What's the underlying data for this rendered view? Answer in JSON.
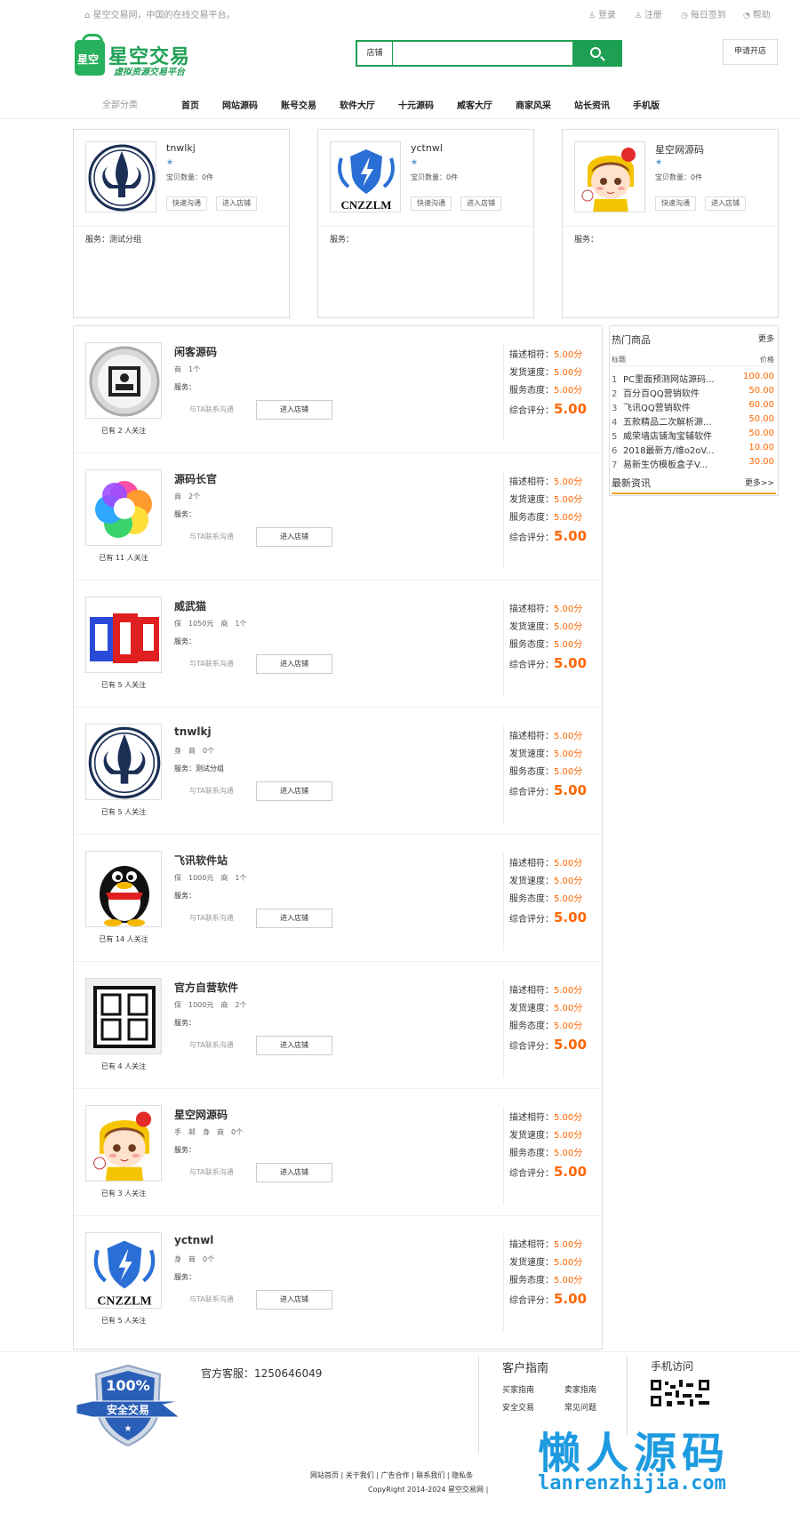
{
  "topbar": {
    "welcome": "星空交易网，中国的在线交易平台。",
    "login": "登录",
    "register": "注册",
    "signin": "每日签到",
    "help": "帮助"
  },
  "header": {
    "logo_badge": "星空",
    "logo_title": "星空交易",
    "logo_sub": "虚拟资源交易平台",
    "search_category": "店铺",
    "search_placeholder": "",
    "apply_label": "申请开店"
  },
  "nav": {
    "all_categories": "全部分类",
    "items": [
      "首页",
      "网站源码",
      "账号交易",
      "软件大厅",
      "十元源码",
      "威客大厅",
      "商家风采",
      "站长资讯",
      "手机版"
    ]
  },
  "featured": [
    {
      "name": "tnwlkj",
      "star": "★",
      "count": "宝贝数量：0件",
      "btn1": "快速沟通",
      "btn2": "进入店铺",
      "service": "服务：测试分组"
    },
    {
      "name": "yctnwl",
      "star": "★",
      "count": "宝贝数量：0件",
      "btn1": "快速沟通",
      "btn2": "进入店铺",
      "service": "服务："
    },
    {
      "name": "星空网源码",
      "star": "★",
      "count": "宝贝数量：0件",
      "btn1": "快速沟通",
      "btn2": "进入店铺",
      "service": "服务："
    }
  ],
  "shops": [
    {
      "name": "闲客源码",
      "meta": "商　1个",
      "service": "服务：",
      "fans": "已有 2 人关注",
      "contact": "与TA联系沟通",
      "enter": "进入店铺",
      "desc_label": "描述相符：",
      "desc": "5.00分",
      "ship_label": "发货速度：",
      "ship": "5.00分",
      "att_label": "服务态度：",
      "att": "5.00分",
      "total_label": "综合评分：",
      "total": "5.00"
    },
    {
      "name": "源码长官",
      "meta": "商　2个",
      "service": "服务：",
      "fans": "已有 11 人关注",
      "contact": "与TA联系沟通",
      "enter": "进入店铺",
      "desc_label": "描述相符：",
      "desc": "5.00分",
      "ship_label": "发货速度：",
      "ship": "5.00分",
      "att_label": "服务态度：",
      "att": "5.00分",
      "total_label": "综合评分：",
      "total": "5.00"
    },
    {
      "name": "威武猫",
      "meta": "保　1050元　商　1个",
      "service": "服务：",
      "fans": "已有 5 人关注",
      "contact": "与TA联系沟通",
      "enter": "进入店铺",
      "desc_label": "描述相符：",
      "desc": "5.00分",
      "ship_label": "发货速度：",
      "ship": "5.00分",
      "att_label": "服务态度：",
      "att": "5.00分",
      "total_label": "综合评分：",
      "total": "5.00"
    },
    {
      "name": "tnwlkj",
      "meta": "身　商　0个",
      "service": "服务：测试分组",
      "fans": "已有 5 人关注",
      "contact": "与TA联系沟通",
      "enter": "进入店铺",
      "desc_label": "描述相符：",
      "desc": "5.00分",
      "ship_label": "发货速度：",
      "ship": "5.00分",
      "att_label": "服务态度：",
      "att": "5.00分",
      "total_label": "综合评分：",
      "total": "5.00"
    },
    {
      "name": "飞讯软件站",
      "meta": "保　1000元　商　1个",
      "service": "服务：",
      "fans": "已有 14 人关注",
      "contact": "与TA联系沟通",
      "enter": "进入店铺",
      "desc_label": "描述相符：",
      "desc": "5.00分",
      "ship_label": "发货速度：",
      "ship": "5.00分",
      "att_label": "服务态度：",
      "att": "5.00分",
      "total_label": "综合评分：",
      "total": "5.00"
    },
    {
      "name": "官方自营软件",
      "meta": "保　1000元　商　2个",
      "service": "服务：",
      "fans": "已有 4 人关注",
      "contact": "与TA联系沟通",
      "enter": "进入店铺",
      "desc_label": "描述相符：",
      "desc": "5.00分",
      "ship_label": "发货速度：",
      "ship": "5.00分",
      "att_label": "服务态度：",
      "att": "5.00分",
      "total_label": "综合评分：",
      "total": "5.00"
    },
    {
      "name": "星空网源码",
      "meta": "手　邮　身　商　0个",
      "service": "服务：",
      "fans": "已有 3 人关注",
      "contact": "与TA联系沟通",
      "enter": "进入店铺",
      "desc_label": "描述相符：",
      "desc": "5.00分",
      "ship_label": "发货速度：",
      "ship": "5.00分",
      "att_label": "服务态度：",
      "att": "5.00分",
      "total_label": "综合评分：",
      "total": "5.00"
    },
    {
      "name": "yctnwl",
      "meta": "身　商　0个",
      "service": "服务：",
      "fans": "已有 5 人关注",
      "contact": "与TA联系沟通",
      "enter": "进入店铺",
      "desc_label": "描述相符：",
      "desc": "5.00分",
      "ship_label": "发货速度：",
      "ship": "5.00分",
      "att_label": "服务态度：",
      "att": "5.00分",
      "total_label": "综合评分：",
      "total": "5.00"
    }
  ],
  "sidebar": {
    "title": "热门商品",
    "more": "更多",
    "col_title": "标题",
    "col_price": "价格",
    "items": [
      {
        "n": "1",
        "t": "PC里面预测网站源码...",
        "p": "100.00"
      },
      {
        "n": "2",
        "t": "百分百QQ营销软件",
        "p": "50.00"
      },
      {
        "n": "3",
        "t": "飞讯QQ营销软件",
        "p": "60.00"
      },
      {
        "n": "4",
        "t": "五款精品二次解析源...",
        "p": "50.00"
      },
      {
        "n": "5",
        "t": "威荣墙店铺淘宝辅软件",
        "p": "50.00"
      },
      {
        "n": "6",
        "t": "2018最新方/维o2oV...",
        "p": "10.00"
      },
      {
        "n": "7",
        "t": "易新生仿模板盒子V...",
        "p": "30.00"
      }
    ],
    "news_title": "最新资讯",
    "news_more": "更多>>"
  },
  "footer": {
    "shield_pct": "100%",
    "shield_text": "安全交易",
    "service_phone": "官方客服：1250646049",
    "guide_title": "客户指南",
    "guide_links": [
      "买家指南",
      "卖家指南",
      "安全交易",
      "常见问题"
    ],
    "mobile_title": "手机访问",
    "links": "网站首页 | 关于我们 | 广告合作 | 联系我们 | 隐私条",
    "copyright": "CopyRight 2014-2024 星空交易网 |",
    "watermark_cn": "懒人源码",
    "watermark_en": "lanrenzhijia.com"
  }
}
